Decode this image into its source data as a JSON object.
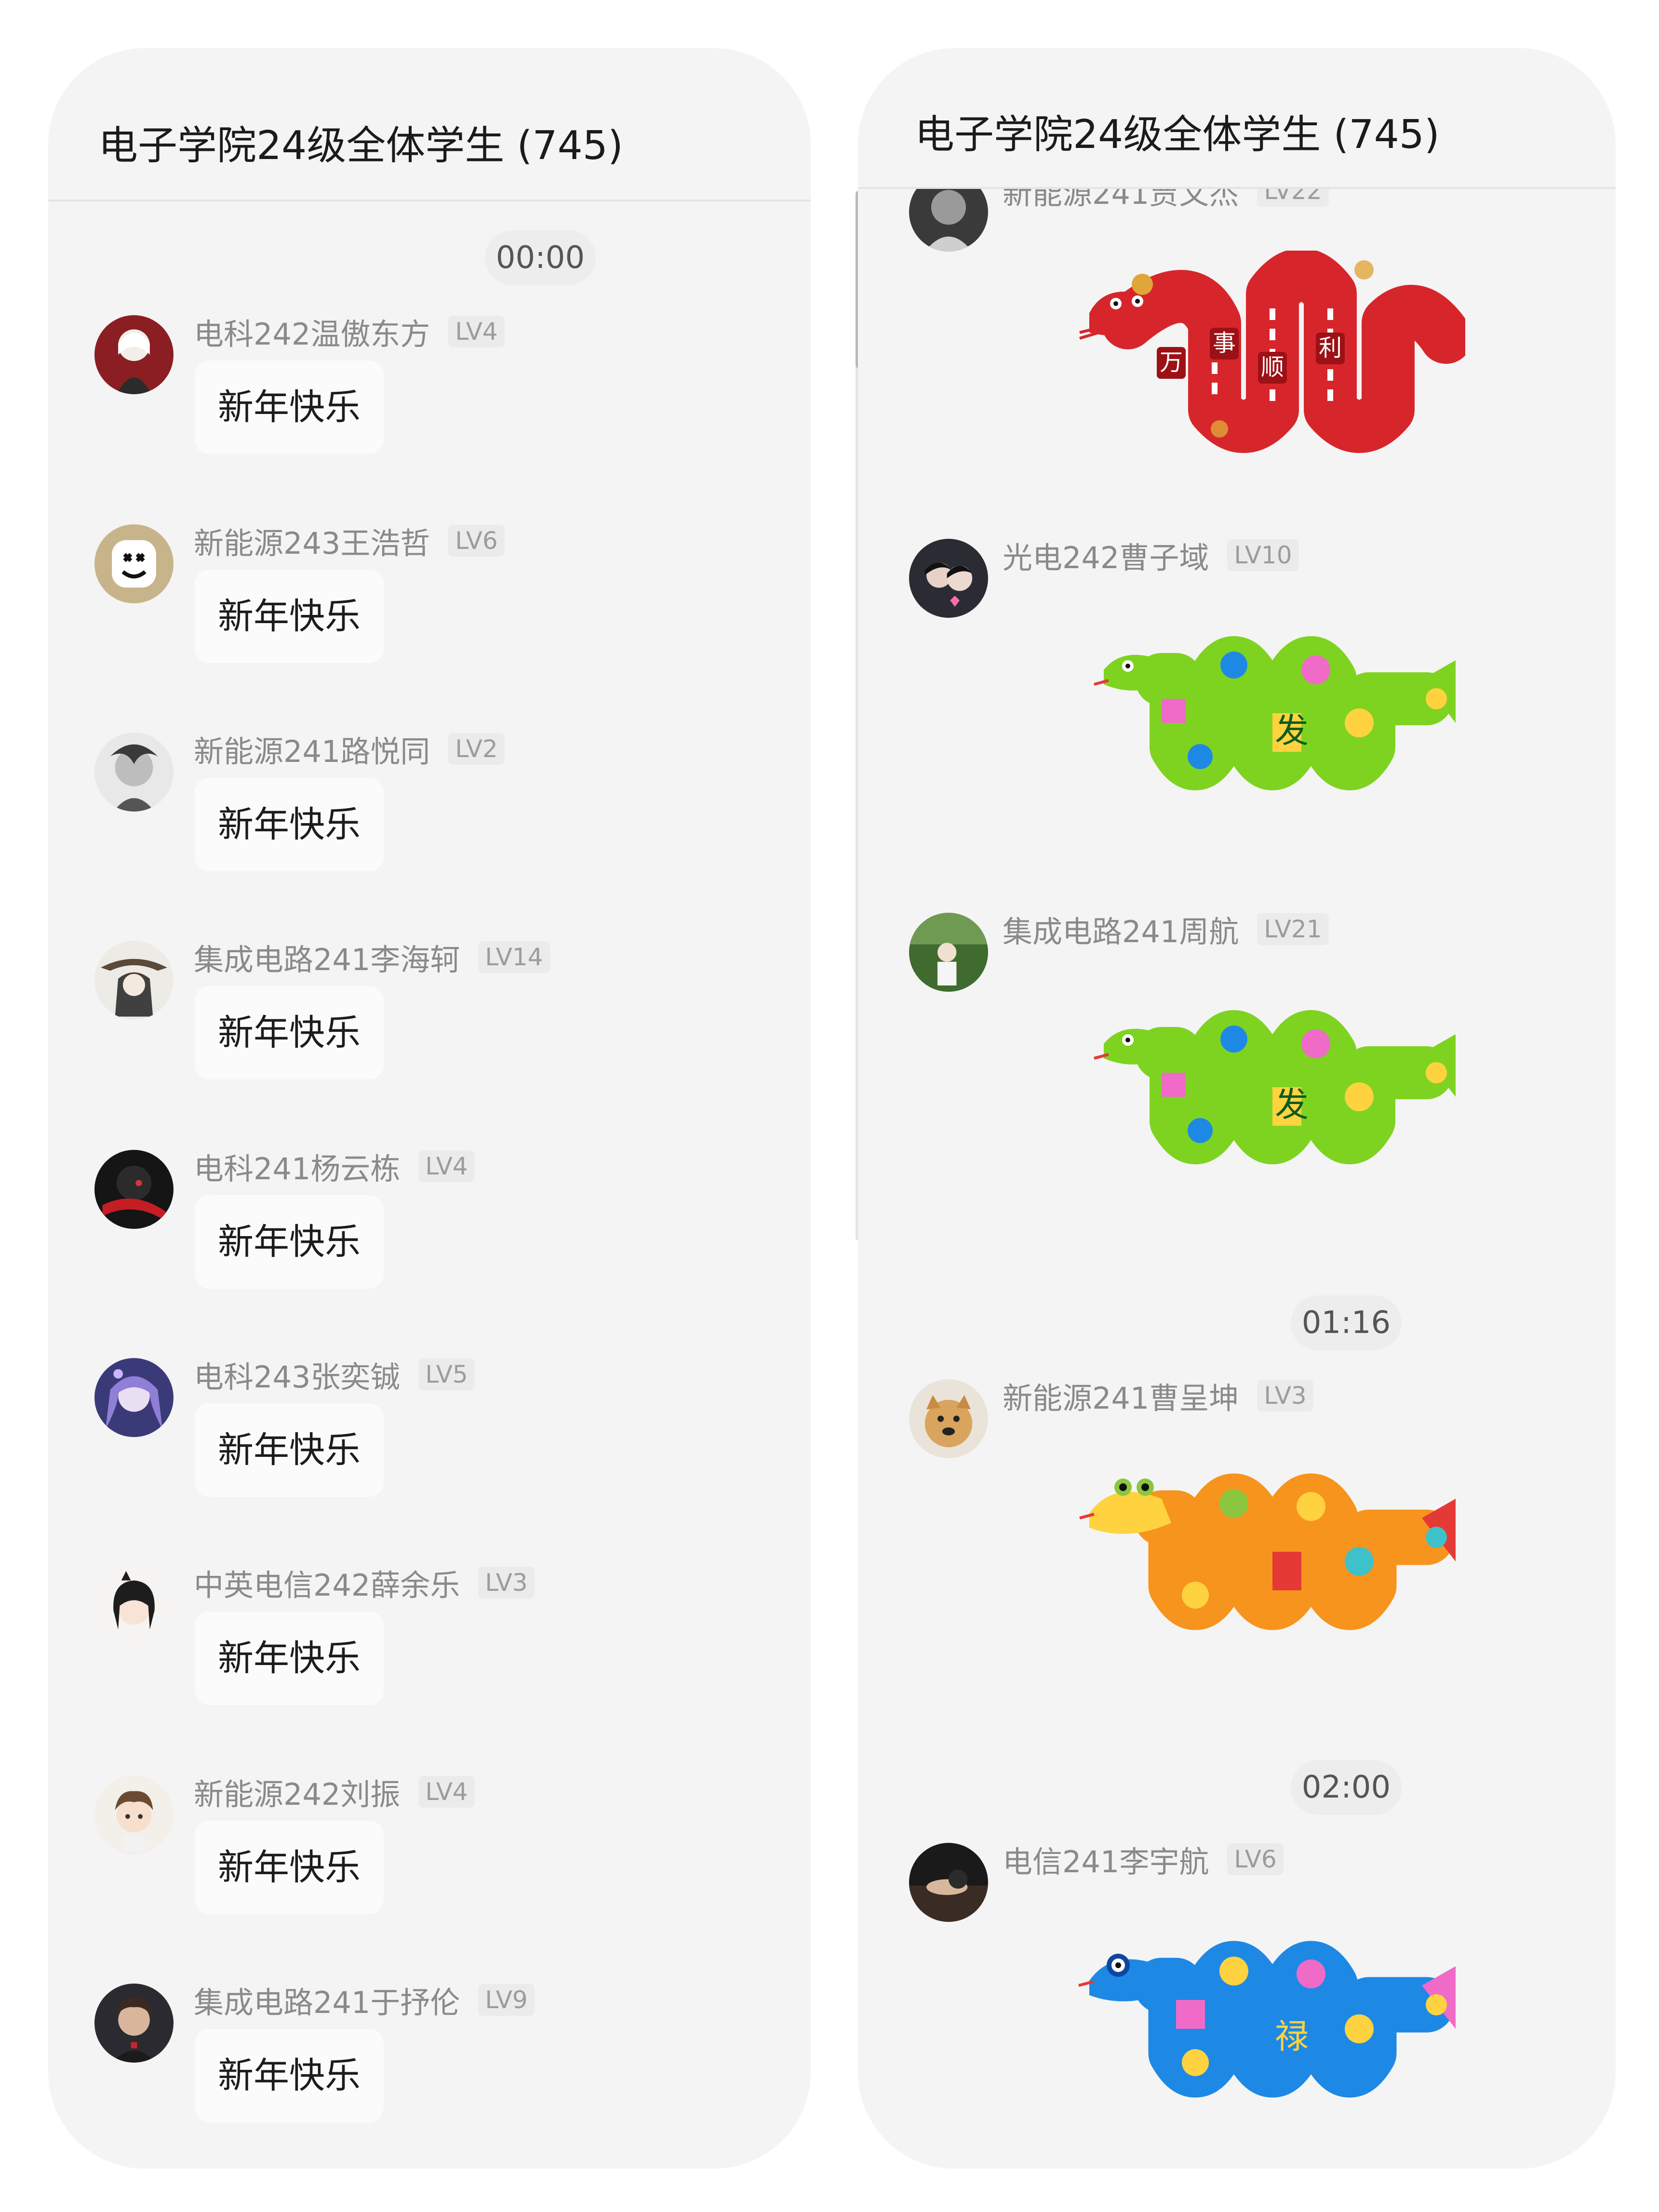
{
  "left_chat": {
    "title": "电子学院24级全体学生 (745)",
    "timestamp": "00:00",
    "messages": [
      {
        "sender": "电科242温傲东方",
        "level": "LV4",
        "text": "新年快乐",
        "avatar": "anime-girl-avatar"
      },
      {
        "sender": "新能源243王浩哲",
        "level": "LV6",
        "text": "新年快乐",
        "avatar": "marshmello-avatar"
      },
      {
        "sender": "新能源241路悦同",
        "level": "LV2",
        "text": "新年快乐",
        "avatar": "sketch-avatar"
      },
      {
        "sender": "集成电路241李海轲",
        "level": "LV14",
        "text": "新年快乐",
        "avatar": "ink-character-avatar"
      },
      {
        "sender": "电科241杨云栋",
        "level": "LV4",
        "text": "新年快乐",
        "avatar": "dark-red-avatar"
      },
      {
        "sender": "电科243张奕铖",
        "level": "LV5",
        "text": "新年快乐",
        "avatar": "purple-anime-avatar"
      },
      {
        "sender": "中英电信242薛余乐",
        "level": "LV3",
        "text": "新年快乐",
        "avatar": "bob-hair-anime-avatar"
      },
      {
        "sender": "新能源242刘振",
        "level": "LV4",
        "text": "新年快乐",
        "avatar": "chibi-avatar"
      },
      {
        "sender": "集成电路241于抒伦",
        "level": "LV9",
        "text": "新年快乐",
        "avatar": "portrait-avatar"
      }
    ]
  },
  "right_chat": {
    "title": "电子学院24级全体学生 (745)",
    "partial_message": {
      "sender": "新能源241贾文杰",
      "level": "LV22",
      "sticker": "red-snake-sticker",
      "sticker_text": [
        "万",
        "事",
        "顺",
        "利"
      ]
    },
    "messages": [
      {
        "sender": "光电242曹子域",
        "level": "LV10",
        "sticker": "green-snake-sticker",
        "sticker_text": "发"
      },
      {
        "sender": "集成电路241周航",
        "level": "LV21",
        "sticker": "green-snake-sticker",
        "sticker_text": "发"
      },
      {
        "timestamp": "01:16",
        "sender": "新能源241曹呈坤",
        "level": "LV3",
        "sticker": "orange-snake-sticker"
      },
      {
        "timestamp": "02:00",
        "sender": "电信241李宇航",
        "level": "LV6",
        "sticker": "blue-snake-sticker",
        "sticker_text": "禄"
      }
    ]
  },
  "colors": {
    "panel_bg": "#f4f4f4",
    "bubble_bg": "#fbfbfb",
    "sender_text": "#8a8a8a",
    "red_snake": "#d7262b",
    "green_snake": "#7ed321",
    "orange_snake": "#f7941d",
    "blue_snake": "#1e88e5"
  }
}
